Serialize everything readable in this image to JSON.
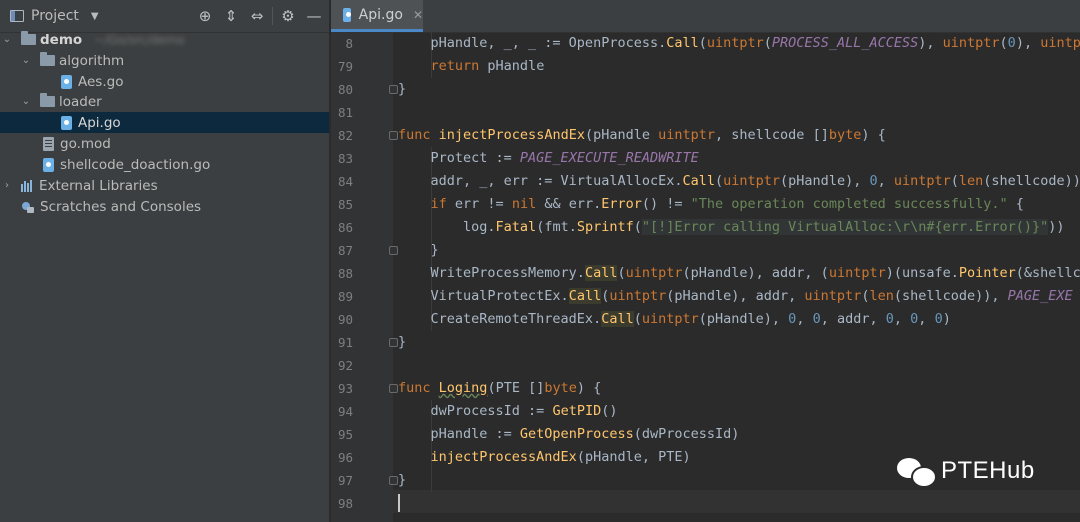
{
  "project_panel": {
    "title": "Project",
    "tree": [
      {
        "label": "demo",
        "blurred": "~/Go/src/demo"
      },
      {
        "label": "algorithm"
      },
      {
        "label": "Aes.go"
      },
      {
        "label": "loader"
      },
      {
        "label": "Api.go"
      },
      {
        "label": "go.mod"
      },
      {
        "label": "shellcode_doaction.go"
      },
      {
        "label": "External Libraries"
      },
      {
        "label": "Scratches and Consoles"
      }
    ]
  },
  "editor": {
    "tab_label": "Api.go",
    "line_numbers": [
      "8",
      "79",
      "80",
      "81",
      "82",
      "83",
      "84",
      "85",
      "86",
      "87",
      "88",
      "89",
      "90",
      "91",
      "92",
      "93",
      "94",
      "95",
      "96",
      "97",
      "98"
    ]
  },
  "watermark": {
    "text": "PTEHub"
  },
  "colors": {
    "panel_bg": "#3c3f41",
    "editor_bg": "#2b2b2b",
    "keyword": "#cc7832",
    "function": "#ffc66d",
    "constant": "#9876aa",
    "number": "#6897bb",
    "string": "#6a8759",
    "selection": "#0d293e"
  }
}
